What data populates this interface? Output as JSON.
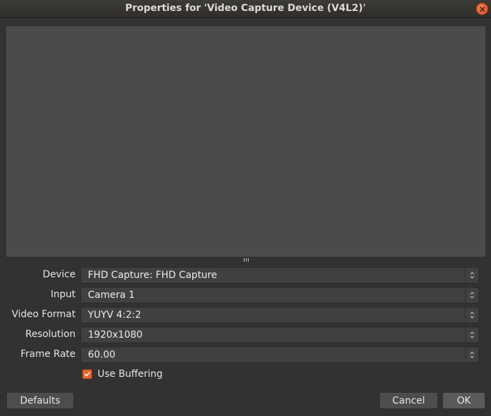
{
  "window": {
    "title": "Properties for 'Video Capture Device (V4L2)'",
    "close_icon": "close-icon"
  },
  "form": {
    "rows": [
      {
        "label": "Device",
        "value": "FHD Capture: FHD Capture"
      },
      {
        "label": "Input",
        "value": "Camera 1"
      },
      {
        "label": "Video Format",
        "value": "YUYV 4:2:2"
      },
      {
        "label": "Resolution",
        "value": "1920x1080"
      },
      {
        "label": "Frame Rate",
        "value": "60.00"
      }
    ],
    "use_buffering": {
      "label": "Use Buffering",
      "checked": true
    }
  },
  "buttons": {
    "defaults": "Defaults",
    "cancel": "Cancel",
    "ok": "OK"
  },
  "colors": {
    "accent": "#e9672f",
    "preview_bg": "#4b4b4b",
    "window_bg": "#323232"
  }
}
